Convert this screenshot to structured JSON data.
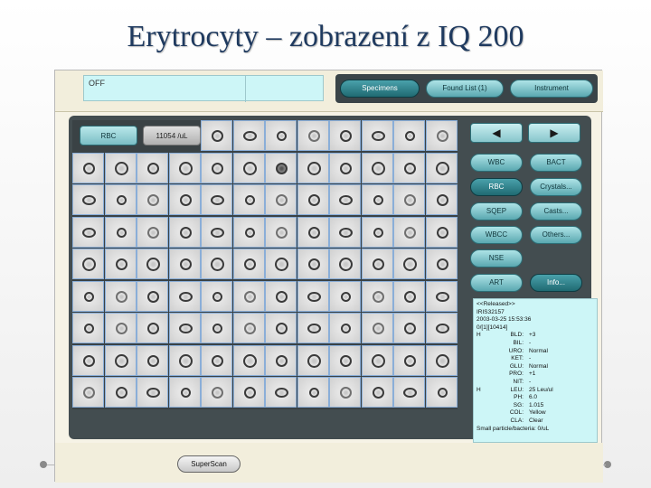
{
  "slide": {
    "title": "Erytrocyty – zobrazení z IQ 200"
  },
  "top_bar": {
    "status_text": "OFF",
    "tabs": [
      {
        "label": "Specimens",
        "active": true
      },
      {
        "label": "Found List (1)",
        "active": false
      },
      {
        "label": "Instrument",
        "active": false
      }
    ]
  },
  "grid": {
    "category_label": "RBC",
    "concentration_label": "11054 /uL",
    "rows": 9,
    "cols": 12
  },
  "side_panel": {
    "left_arrow": "◀",
    "right_arrow": "▶",
    "buttons": [
      {
        "label": "WBC",
        "active": false
      },
      {
        "label": "BACT",
        "active": false
      },
      {
        "label": "RBC",
        "active": true
      },
      {
        "label": "Crystals...",
        "active": false
      },
      {
        "label": "SQEP",
        "active": false
      },
      {
        "label": "Casts...",
        "active": false
      },
      {
        "label": "WBCC",
        "active": false
      },
      {
        "label": "Others...",
        "active": false
      },
      {
        "label": "NSE",
        "active": false
      },
      {
        "label": "ART",
        "active": false
      },
      {
        "label": "Info...",
        "active": true
      }
    ]
  },
  "info": {
    "header": "<<Released>>",
    "id": "IRIS32157",
    "datetime": "2003-03-25 15:53:36",
    "code": "0/[1][10414]",
    "rows": [
      {
        "flag": "H",
        "label": "BLD:",
        "value": "+3"
      },
      {
        "flag": "",
        "label": "BIL:",
        "value": "-"
      },
      {
        "flag": "",
        "label": "URO:",
        "value": "Normal"
      },
      {
        "flag": "",
        "label": "KET:",
        "value": "-"
      },
      {
        "flag": "",
        "label": "GLU:",
        "value": "Normal"
      },
      {
        "flag": "",
        "label": "PRO:",
        "value": "+1"
      },
      {
        "flag": "",
        "label": "NIT:",
        "value": "-"
      },
      {
        "flag": "H",
        "label": "LEU:",
        "value": "25 Leu/ul"
      },
      {
        "flag": "",
        "label": "PH:",
        "value": "6.0"
      },
      {
        "flag": "",
        "label": "SG:",
        "value": "1.015"
      },
      {
        "flag": "",
        "label": "COL:",
        "value": "Yellow"
      },
      {
        "flag": "",
        "label": "CLA:",
        "value": "Clear"
      }
    ],
    "footer": "Small particle/bacteria: 0/uL"
  },
  "bottom_bar": {
    "superscan_label": "SuperScan"
  }
}
